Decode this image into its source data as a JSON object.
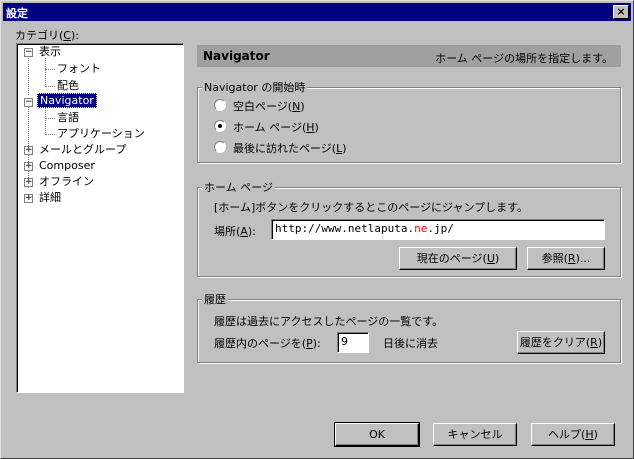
{
  "window": {
    "title": "設定",
    "close_glyph": "×"
  },
  "category_label": "カテゴリ(",
  "category_key": "C",
  "category_label_end": "):",
  "tree": {
    "items": [
      {
        "label": "表示",
        "expander": "−"
      },
      {
        "label": "フォント"
      },
      {
        "label": "配色"
      },
      {
        "label": "Navigator",
        "expander": "−",
        "selected": true
      },
      {
        "label": "言語"
      },
      {
        "label": "アプリケーション"
      },
      {
        "label": "メールとグループ",
        "expander": "+"
      },
      {
        "label": "Composer",
        "expander": "+"
      },
      {
        "label": "オフライン",
        "expander": "+"
      },
      {
        "label": "詳細",
        "expander": "+"
      }
    ]
  },
  "header": {
    "title": "Navigator",
    "description": "ホーム ページの場所を指定します。"
  },
  "startup": {
    "label": "Navigator の開始時",
    "options": [
      {
        "text": "空白ページ(",
        "key": "N",
        "end": ")",
        "selected": false
      },
      {
        "text": "ホーム ページ(",
        "key": "H",
        "end": ")",
        "selected": true
      },
      {
        "text": "最後に訪れたページ(",
        "key": "L",
        "end": ")",
        "selected": false
      }
    ]
  },
  "homepage": {
    "label": "ホーム ページ",
    "description": "[ホーム]ボタンをクリックするとこのページにジャンプします。",
    "location_label": "場所(",
    "location_key": "A",
    "location_end": "):",
    "url_prefix": "http://www.netlaputa.",
    "url_highlight": "ne",
    "url_suffix": ".jp/",
    "url_highlight_color": "#ff0000",
    "current_page_button": "現在のページ(",
    "current_page_key": "U",
    "browse_button": "参照(",
    "browse_key": "R",
    "browse_end": ")..."
  },
  "history": {
    "label": "履歴",
    "description": "履歴は過去にアクセスしたページの一覧です。",
    "days_label": "履歴内のページを(",
    "days_key": "P",
    "days_end": "):",
    "days_value": "9",
    "days_suffix": "日後に消去",
    "clear_button": "履歴をクリア(",
    "clear_key": "R"
  },
  "buttons": {
    "ok": "OK",
    "cancel": "キャンセル",
    "help": "ヘルプ(",
    "help_key": "H",
    "close_paren": ")"
  }
}
